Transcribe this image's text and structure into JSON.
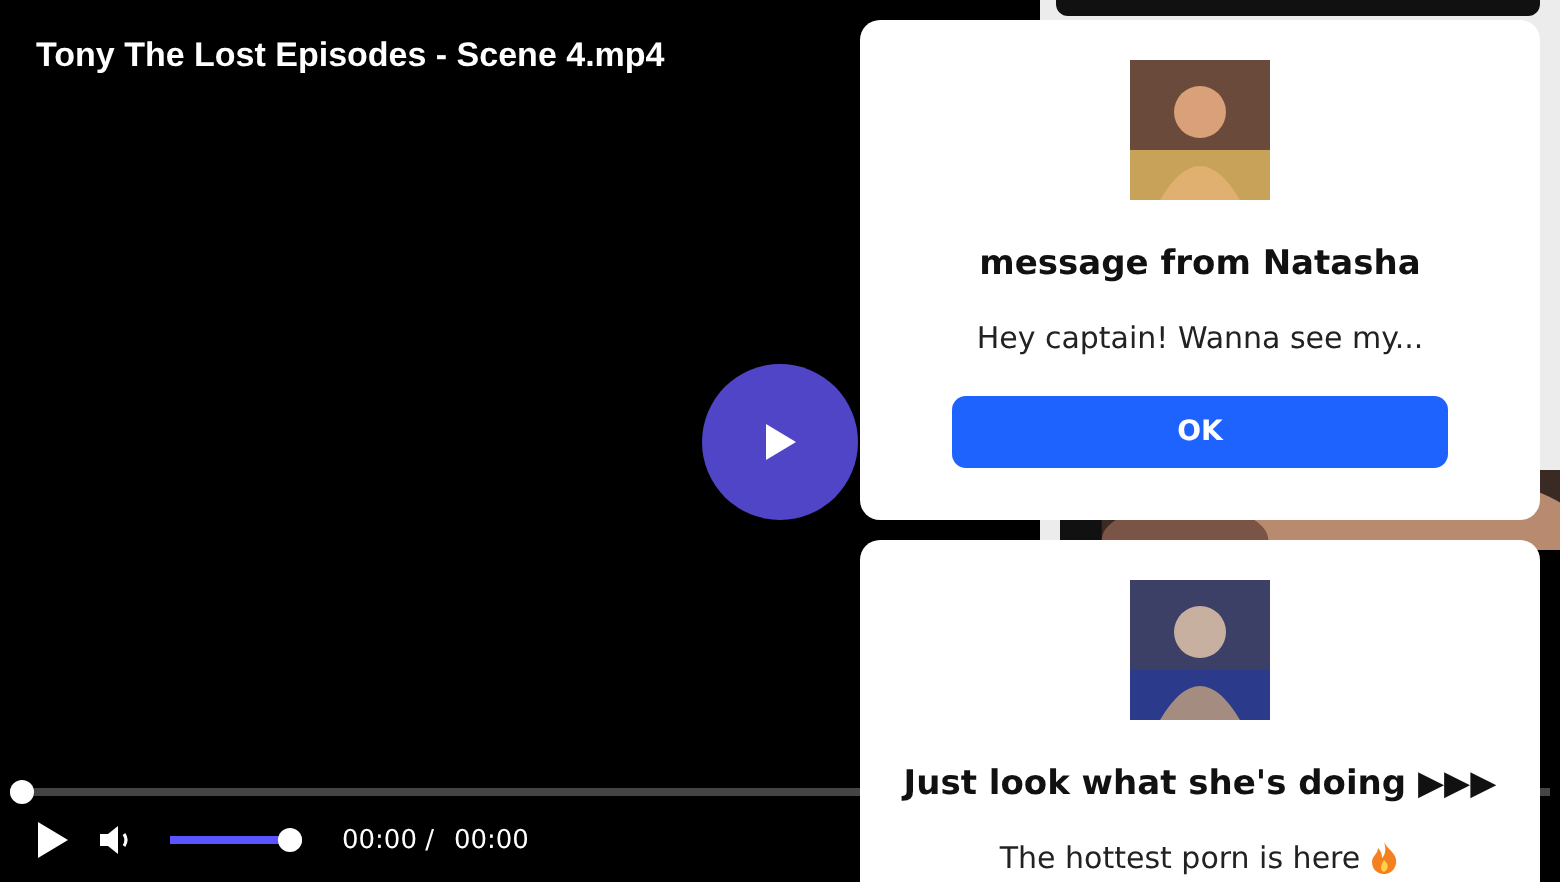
{
  "video": {
    "title": "Tony The Lost Episodes - Scene 4.mp4",
    "progress": {
      "level": 0
    },
    "volume": {
      "level": 1
    },
    "time_current": "00:00 /",
    "time_total": "00:00"
  },
  "popups": [
    {
      "title": "message from Natasha",
      "text": "Hey captain! Wanna see my...",
      "button": "OK",
      "fire_icon": false
    },
    {
      "title": "Just look what she's doing ▶▶▶",
      "text": "The hottest porn is here",
      "fire_icon": true
    }
  ]
}
